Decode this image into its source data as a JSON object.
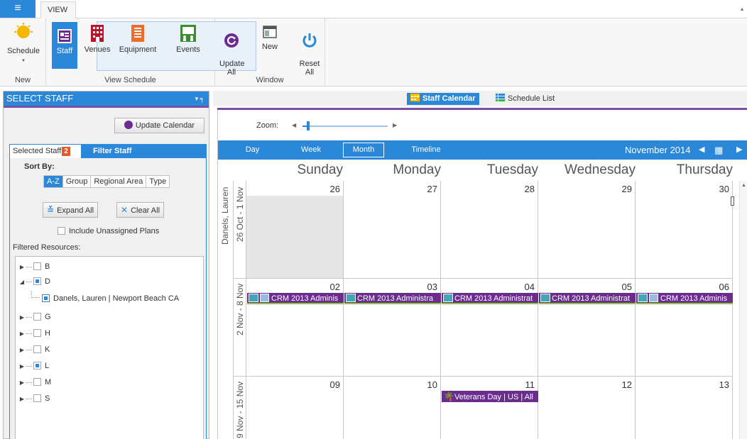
{
  "ribbon": {
    "menu_glyph": "≡",
    "tab_view": "VIEW",
    "collapse_glyph": "▴",
    "groups": {
      "new": {
        "label": "New",
        "schedule": "Schedule"
      },
      "view_schedule": {
        "label": "View Schedule",
        "staff": "Staff",
        "venues": "Venues",
        "equipment": "Equipment",
        "events": "Events"
      },
      "window": {
        "label": "Window",
        "update_all": "Update\nAll",
        "new": "New",
        "reset_all": "Reset\nAll"
      }
    }
  },
  "left_panel": {
    "title": "SELECT STAFF",
    "header_icons": "▾ ╕",
    "update_calendar": "Update Calendar",
    "tabs": {
      "selected_staff": "Selected Staff",
      "selected_count": "2",
      "filter_staff": "Filter Staff"
    },
    "sort_by_label": "Sort By:",
    "sort_options": [
      "A-Z",
      "Group",
      "Regional Area",
      "Type"
    ],
    "expand_all": "Expand All",
    "clear_all": "Clear All",
    "include_unassigned": "Include Unassigned Plans",
    "filtered_resources_label": "Filtered Resources:",
    "tree": [
      {
        "label": "B",
        "state": "none",
        "expanded": false
      },
      {
        "label": "D",
        "state": "part",
        "expanded": true
      },
      {
        "label": "Danels, Lauren | Newport Beach CA",
        "state": "full",
        "child": true
      },
      {
        "label": "G",
        "state": "none",
        "expanded": false
      },
      {
        "label": "H",
        "state": "none",
        "expanded": false
      },
      {
        "label": "K",
        "state": "none",
        "expanded": false
      },
      {
        "label": "L",
        "state": "part",
        "expanded": false
      },
      {
        "label": "M",
        "state": "none",
        "expanded": false
      },
      {
        "label": "S",
        "state": "none",
        "expanded": false
      }
    ]
  },
  "right_panel": {
    "staff_calendar": "Staff Calendar",
    "schedule_list": "Schedule List",
    "zoom_label": "Zoom:",
    "zoom_level": 0.05,
    "nav_tabs": [
      "Day",
      "Week",
      "Month",
      "Timeline"
    ],
    "active_nav": "Month",
    "month_title": "November 2014",
    "day_names": [
      "Sunday",
      "Monday",
      "Tuesday",
      "Wednesday",
      "Thursday"
    ],
    "resource_name": "Danels, Lauren",
    "weeks": [
      {
        "range": "26 Oct - 1 Nov",
        "days": [
          "26",
          "27",
          "28",
          "29",
          "30"
        ]
      },
      {
        "range": "2 Nov - 8 Nov",
        "days": [
          "02",
          "03",
          "04",
          "05",
          "06"
        ]
      },
      {
        "range": "9 Nov - 15 Nov",
        "days": [
          "09",
          "10",
          "11",
          "12",
          "13"
        ]
      }
    ],
    "events": {
      "crm_mon": "CRM 2013 Adminis",
      "crm_tue": "CRM 2013 Administra",
      "crm_wed": "CRM 2013 Administrat",
      "crm_thu": "CRM 2013 Administrat",
      "crm_fri": "CRM 2013 Adminis",
      "veterans": "Veterans Day | US | All"
    },
    "colors": {
      "accent": "#2b88d8",
      "event": "#6a2d8f",
      "separator": "#7b4fa8",
      "event_underline": "#8dc63f"
    }
  }
}
